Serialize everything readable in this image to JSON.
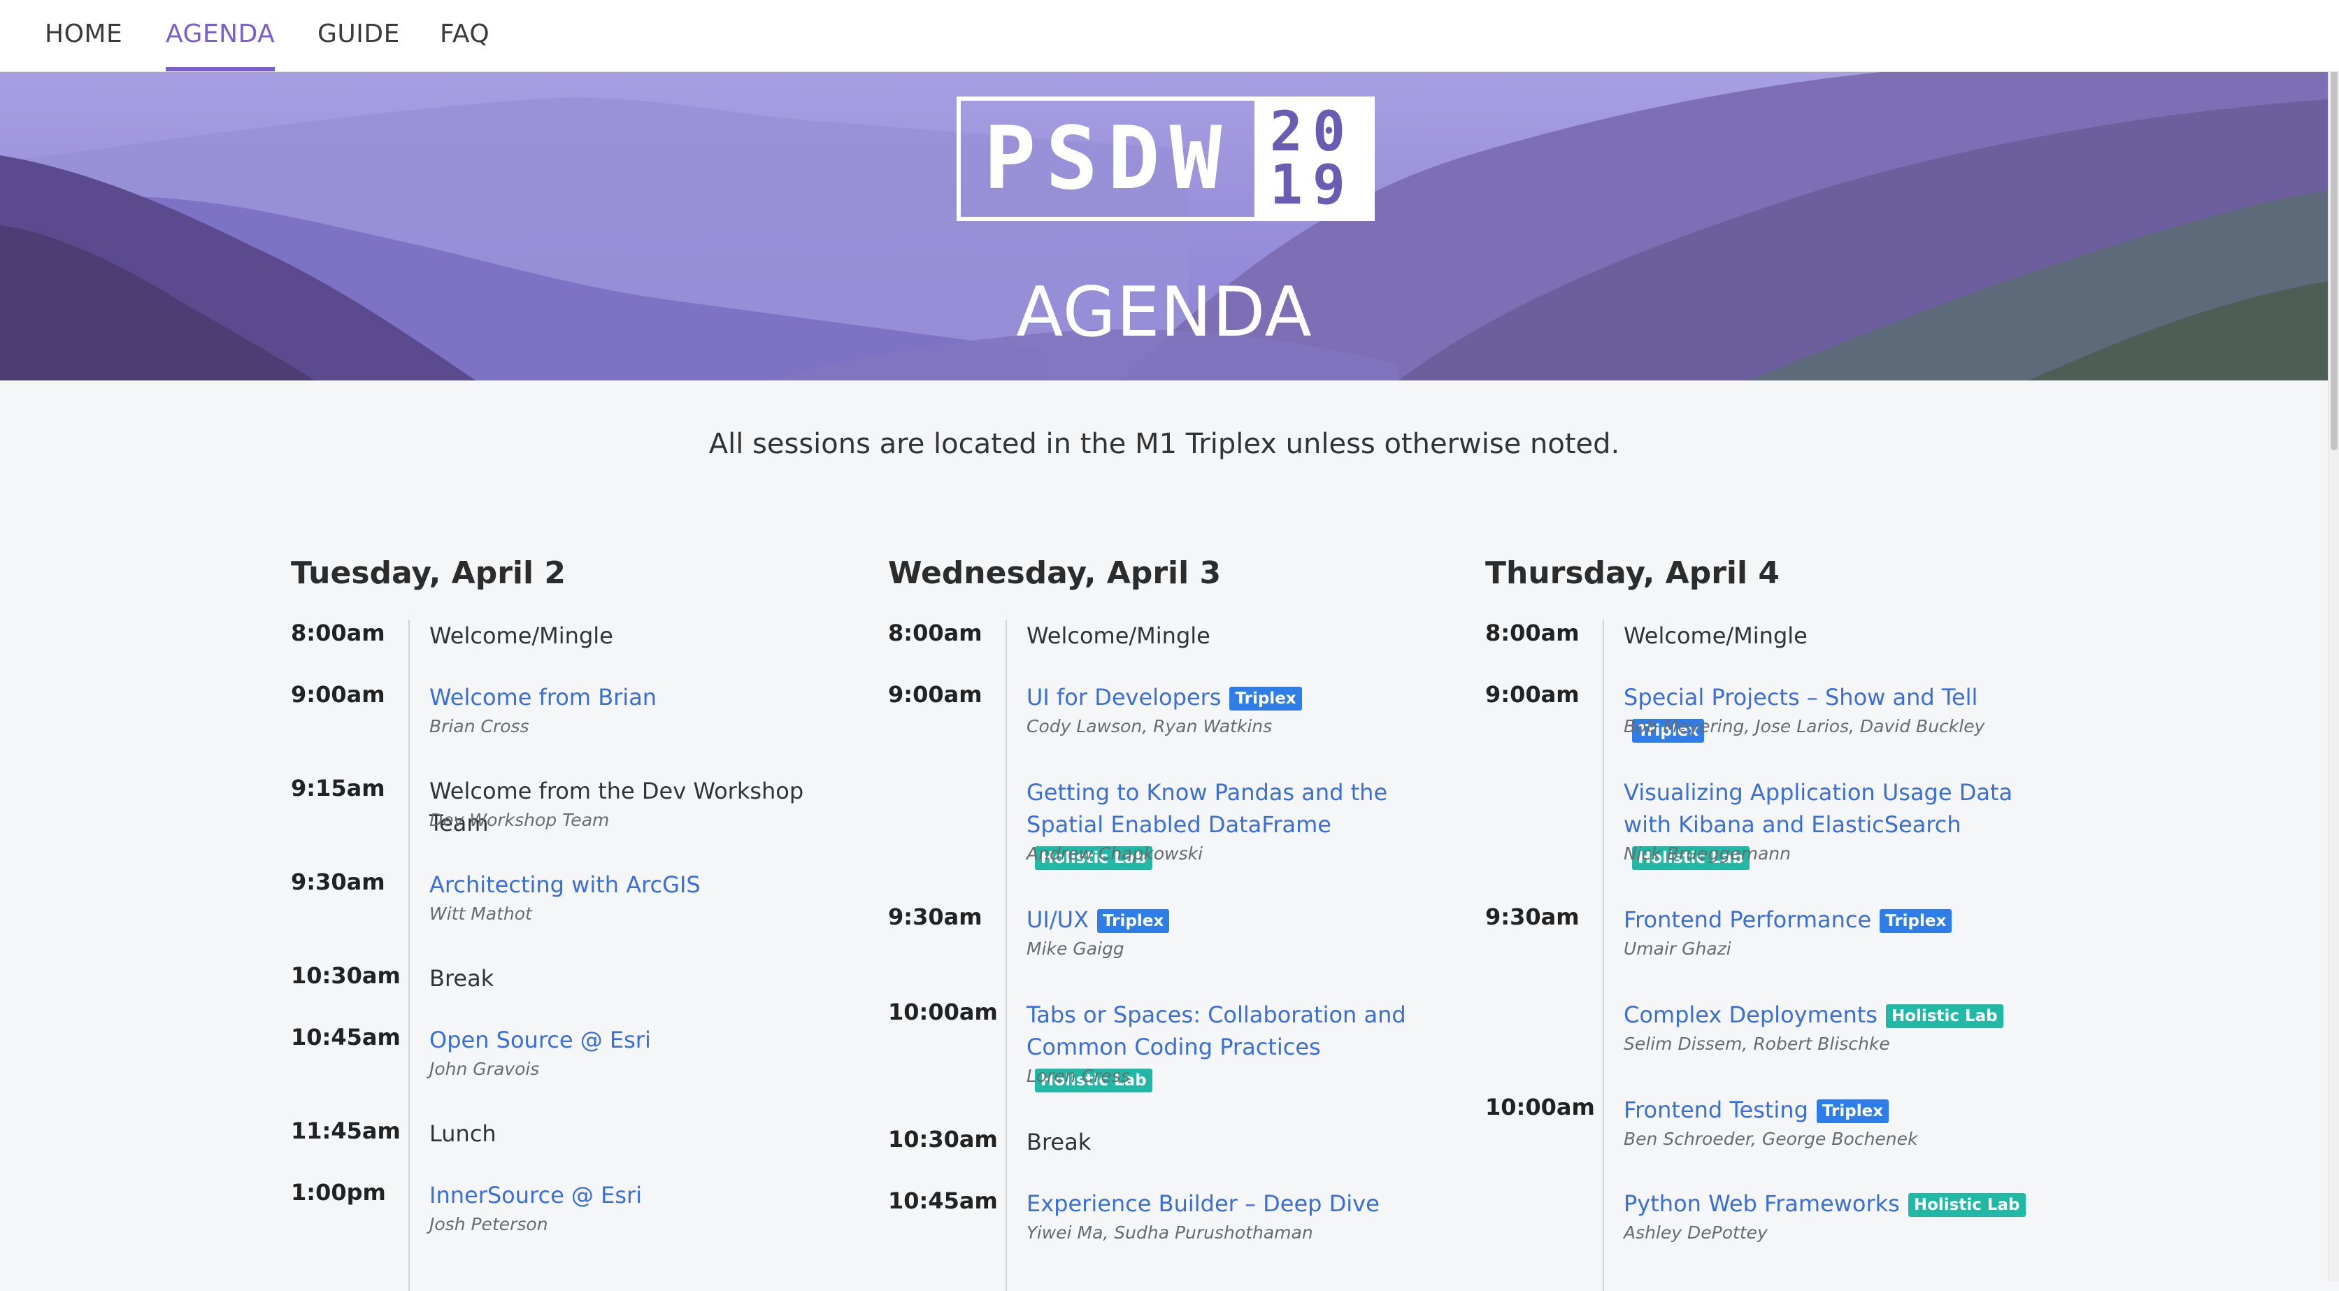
{
  "nav": {
    "items": [
      {
        "label": "HOME"
      },
      {
        "label": "AGENDA",
        "active": true
      },
      {
        "label": "GUIDE"
      },
      {
        "label": "FAQ"
      }
    ]
  },
  "hero": {
    "logo_text": "PSDW",
    "logo_year_top": "20",
    "logo_year_bottom": "19",
    "title": "AGENDA"
  },
  "intro": "All sessions are located in the M1 Triplex unless otherwise noted.",
  "colors": {
    "accent": "#7a5dce",
    "link": "#3a6ed8",
    "badge_triplex": "#2f7de6",
    "badge_holistic": "#21b9a6"
  },
  "days": [
    {
      "title": "Tuesday, April 2",
      "sessions": [
        {
          "time": "8:00am",
          "title": "Welcome/Mingle",
          "link": false,
          "speaker": "",
          "badge": ""
        },
        {
          "time": "9:00am",
          "title": "Welcome from Brian",
          "link": true,
          "speaker": "Brian Cross",
          "badge": ""
        },
        {
          "time": "9:15am",
          "title": "Welcome from the Dev Workshop Team",
          "link": false,
          "speaker": "Dev Workshop Team",
          "badge": ""
        },
        {
          "time": "9:30am",
          "title": "Architecting with ArcGIS",
          "link": true,
          "speaker": "Witt Mathot",
          "badge": ""
        },
        {
          "time": "10:30am",
          "title": "Break",
          "link": false,
          "speaker": "",
          "badge": ""
        },
        {
          "time": "10:45am",
          "title": "Open Source @ Esri",
          "link": true,
          "speaker": "John Gravois",
          "badge": ""
        },
        {
          "time": "11:45am",
          "title": "Lunch",
          "link": false,
          "speaker": "",
          "badge": ""
        },
        {
          "time": "1:00pm",
          "title": "InnerSource @ Esri",
          "link": true,
          "speaker": "Josh Peterson",
          "badge": ""
        }
      ]
    },
    {
      "title": "Wednesday, April 3",
      "sessions": [
        {
          "time": "8:00am",
          "title": "Welcome/Mingle",
          "link": false,
          "speaker": "",
          "badge": ""
        },
        {
          "time": "9:00am",
          "title": "UI for Developers",
          "link": true,
          "speaker": "Cody Lawson, Ryan Watkins",
          "badge": "Triplex"
        },
        {
          "time": "",
          "title": "Getting to Know Pandas and the Spatial Enabled DataFrame",
          "link": true,
          "speaker": "Andrew Chapkowski",
          "badge": "Holistic Lab"
        },
        {
          "time": "9:30am",
          "title": "UI/UX",
          "link": true,
          "speaker": "Mike Gaigg",
          "badge": "Triplex"
        },
        {
          "time": "10:00am",
          "title": "Tabs or Spaces: Collaboration and Common Coding Practices",
          "link": true,
          "speaker": "Loren Cress",
          "badge": "Holistic Lab"
        },
        {
          "time": "10:30am",
          "title": "Break",
          "link": false,
          "speaker": "",
          "badge": ""
        },
        {
          "time": "10:45am",
          "title": "Experience Builder – Deep Dive",
          "link": true,
          "speaker": "Yiwei Ma, Sudha Purushothaman",
          "badge": ""
        }
      ]
    },
    {
      "title": "Thursday, April 4",
      "sessions": [
        {
          "time": "8:00am",
          "title": "Welcome/Mingle",
          "link": false,
          "speaker": "",
          "badge": ""
        },
        {
          "time": "9:00am",
          "title": "Special Projects – Show and Tell",
          "link": true,
          "speaker": "Bob Meyering, Jose Larios, David Buckley",
          "badge": "Triplex"
        },
        {
          "time": "",
          "title": "Visualizing Application Usage Data with Kibana and ElasticSearch",
          "link": true,
          "speaker": "Nick Brueggemann",
          "badge": "Holistic Lab"
        },
        {
          "time": "9:30am",
          "title": "Frontend Performance",
          "link": true,
          "speaker": "Umair Ghazi",
          "badge": "Triplex"
        },
        {
          "time": "",
          "title": "Complex Deployments",
          "link": true,
          "speaker": "Selim Dissem, Robert Blischke",
          "badge": "Holistic Lab"
        },
        {
          "time": "10:00am",
          "title": "Frontend Testing",
          "link": true,
          "speaker": "Ben Schroeder, George Bochenek",
          "badge": "Triplex"
        },
        {
          "time": "",
          "title": "Python Web Frameworks",
          "link": true,
          "speaker": "Ashley DePottey",
          "badge": "Holistic Lab"
        }
      ]
    }
  ]
}
